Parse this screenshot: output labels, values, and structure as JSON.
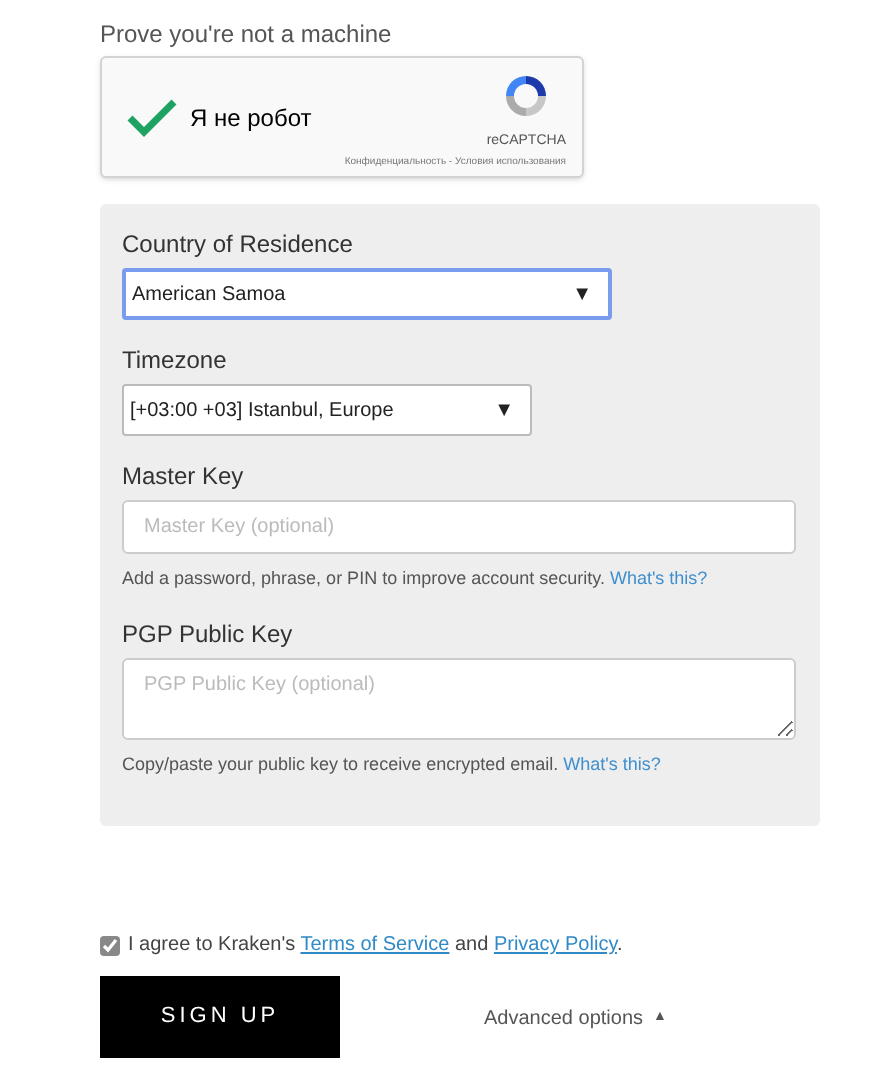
{
  "captcha": {
    "heading": "Prove you're not a machine",
    "checked": true,
    "label": "Я не робот",
    "brand": "reCAPTCHA",
    "footer": "Конфиденциальность - Условия использования"
  },
  "fields": [
    {
      "kind": "select",
      "label": "Country of Residence",
      "value": "American Samoa",
      "arrow": "▼",
      "focused": true
    },
    {
      "kind": "select",
      "label": "Timezone",
      "value": "[+03:00 +03] Istanbul, Europe",
      "arrow": "▼",
      "focused": false
    },
    {
      "kind": "input",
      "label": "Master Key",
      "placeholder": "Master Key (optional)",
      "help": "Add a password, phrase, or PIN to improve account security.",
      "help_link": "What's this?"
    },
    {
      "kind": "textarea",
      "label": "PGP Public Key",
      "placeholder": "PGP Public Key (optional)",
      "help": "Copy/paste your public key to receive encrypted email.",
      "help_link": "What's this?"
    }
  ],
  "agreement": {
    "checked": true,
    "parts": [
      {
        "kind": "text",
        "text": "I agree to Kraken's "
      },
      {
        "kind": "link",
        "text": "Terms of Service"
      },
      {
        "kind": "text",
        "text": " and "
      },
      {
        "kind": "link",
        "text": "Privacy Policy"
      },
      {
        "kind": "text",
        "text": "."
      }
    ]
  },
  "sign_up": "SIGN UP",
  "advanced": {
    "label": "Advanced options",
    "arrow": "▲"
  }
}
